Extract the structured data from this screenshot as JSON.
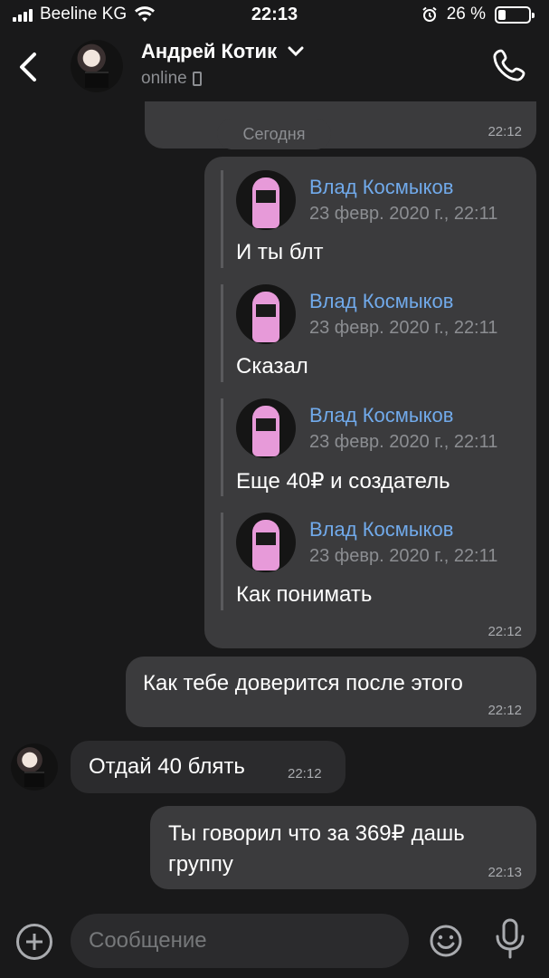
{
  "status_bar": {
    "carrier": "Beeline KG",
    "time": "22:13",
    "battery": "26 %",
    "battery_level": 0.26
  },
  "header": {
    "contact_name": "Андрей Котик",
    "presence": "online",
    "icons": [
      "back-chevron-icon",
      "chevron-down-icon",
      "mobile-device-icon",
      "phone-icon"
    ]
  },
  "chat": {
    "prev_message_time": "22:12",
    "date_separator": "Сегодня",
    "forwarded_group": {
      "time": "22:12",
      "items": [
        {
          "author": "Влад Космыков",
          "date": "23 февр. 2020 г., 22:11",
          "text": "И ты блт"
        },
        {
          "author": "Влад Космыков",
          "date": "23 февр. 2020 г., 22:11",
          "text": "Сказал"
        },
        {
          "author": "Влад Космыков",
          "date": "23 февр. 2020 г., 22:11",
          "text": "Еще 40₽ и создатель"
        },
        {
          "author": "Влад Космыков",
          "date": "23 февр. 2020 г., 22:11",
          "text": "Как понимать"
        }
      ]
    },
    "messages": [
      {
        "direction": "out",
        "text": "Как тебе доверится после этого",
        "time": "22:12"
      },
      {
        "direction": "in",
        "text": "Отдай 40 блять",
        "time": "22:12"
      },
      {
        "direction": "out",
        "text": "Ты говорил что за 369₽ дашь группу",
        "time": "22:13"
      }
    ]
  },
  "input_bar": {
    "placeholder": "Сообщение",
    "icons": [
      "add-icon",
      "emoji-icon",
      "microphone-icon"
    ]
  }
}
